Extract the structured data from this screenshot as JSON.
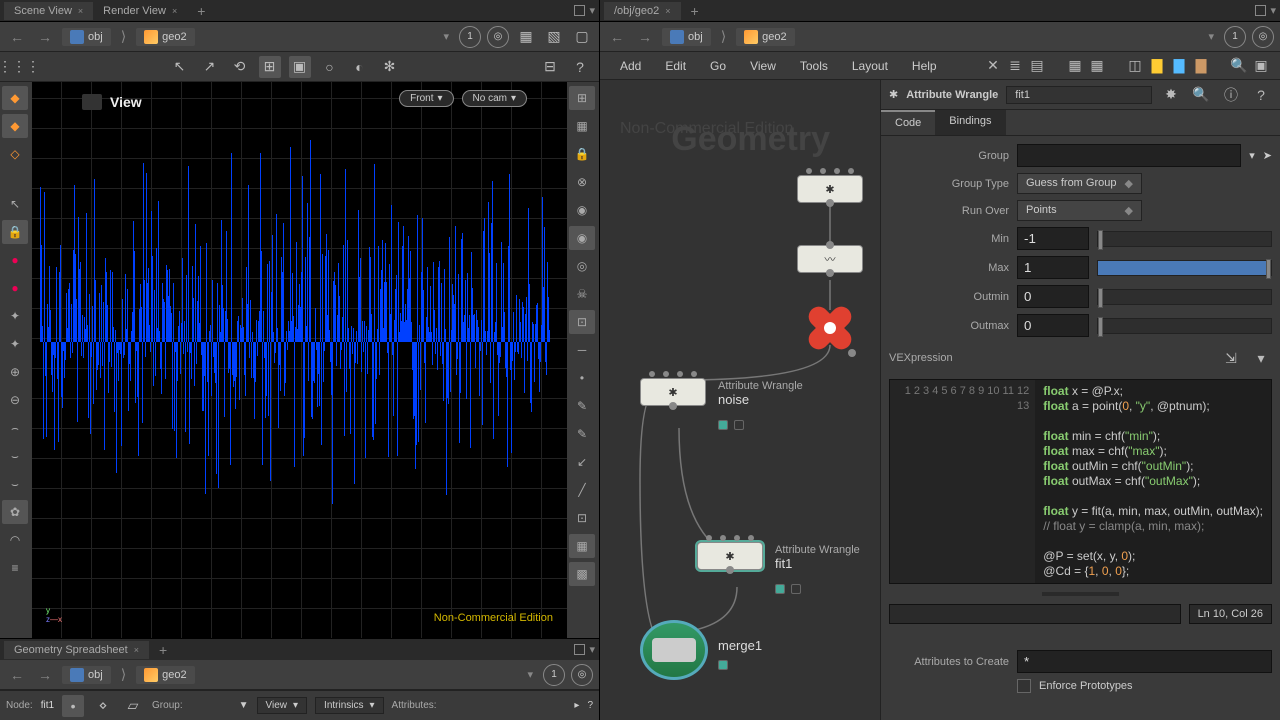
{
  "left_tabs": [
    "Scene View",
    "Render View"
  ],
  "right_tabs": [
    "/obj/geo2"
  ],
  "sub_tabs": [
    "Geometry Spreadsheet"
  ],
  "path": {
    "obj": "obj",
    "geo": "geo2"
  },
  "view": {
    "title": "View",
    "front": "Front",
    "nocam": "No cam",
    "watermark": "Non-Commercial Edition"
  },
  "menus": [
    "Add",
    "Edit",
    "Go",
    "View",
    "Tools",
    "Layout",
    "Help"
  ],
  "bg_text": "Geometry",
  "nodes": {
    "noise": {
      "type": "Attribute Wrangle",
      "name": "noise"
    },
    "fit1": {
      "type": "Attribute Wrangle",
      "name": "fit1"
    },
    "merge": {
      "name": "merge1"
    }
  },
  "params": {
    "title": "Attribute Wrangle",
    "name": "fit1",
    "tabs": [
      "Code",
      "Bindings"
    ],
    "group": {
      "label": "Group",
      "value": ""
    },
    "group_type": {
      "label": "Group Type",
      "value": "Guess from Group"
    },
    "run_over": {
      "label": "Run Over",
      "value": "Points"
    },
    "min": {
      "label": "Min",
      "value": "-1"
    },
    "max": {
      "label": "Max",
      "value": "1"
    },
    "outmin": {
      "label": "Outmin",
      "value": "0"
    },
    "outmax": {
      "label": "Outmax",
      "value": "0"
    },
    "vexpression": "VEXpression",
    "attrs_create": {
      "label": "Attributes to Create",
      "value": "*"
    },
    "enforce": "Enforce Prototypes",
    "cursor": "Ln 10, Col 26"
  },
  "code_lines": [
    1,
    2,
    3,
    4,
    5,
    6,
    7,
    8,
    9,
    10,
    11,
    12,
    13
  ],
  "code": {
    "l1a": "float",
    "l1b": " x = @P.x;",
    "l2a": "float",
    "l2b": " a = point(",
    "l2c": "0",
    "l2d": ", ",
    "l2e": "\"y\"",
    "l2f": ", @ptnum);",
    "l4a": "float",
    "l4b": " min = chf(",
    "l4c": "\"min\"",
    "l4d": ");",
    "l5a": "float",
    "l5b": " max = chf(",
    "l5c": "\"max\"",
    "l5d": ");",
    "l6a": "float",
    "l6b": " outMin = chf(",
    "l6c": "\"outMin\"",
    "l6d": ");",
    "l7a": "float",
    "l7b": " outMax = chf(",
    "l7c": "\"outMax\"",
    "l7d": ");",
    "l9a": "float",
    "l9b": " y = fit(a, min, max, outMin, outMax);",
    "l10": "// float y = clamp(a, min, max);",
    "l12a": "@P = set(x, y, ",
    "l12b": "0",
    "l12c": ");",
    "l13a": "@Cd = {",
    "l13b": "1",
    "l13c": ", ",
    "l13d": "0",
    "l13e": ", ",
    "l13f": "0",
    "l13g": "};"
  },
  "bottom": {
    "node_label": "Node:",
    "node": "fit1",
    "group_label": "Group:",
    "view": "View",
    "intrinsics": "Intrinsics",
    "attrs": "Attributes:"
  },
  "one": "1"
}
